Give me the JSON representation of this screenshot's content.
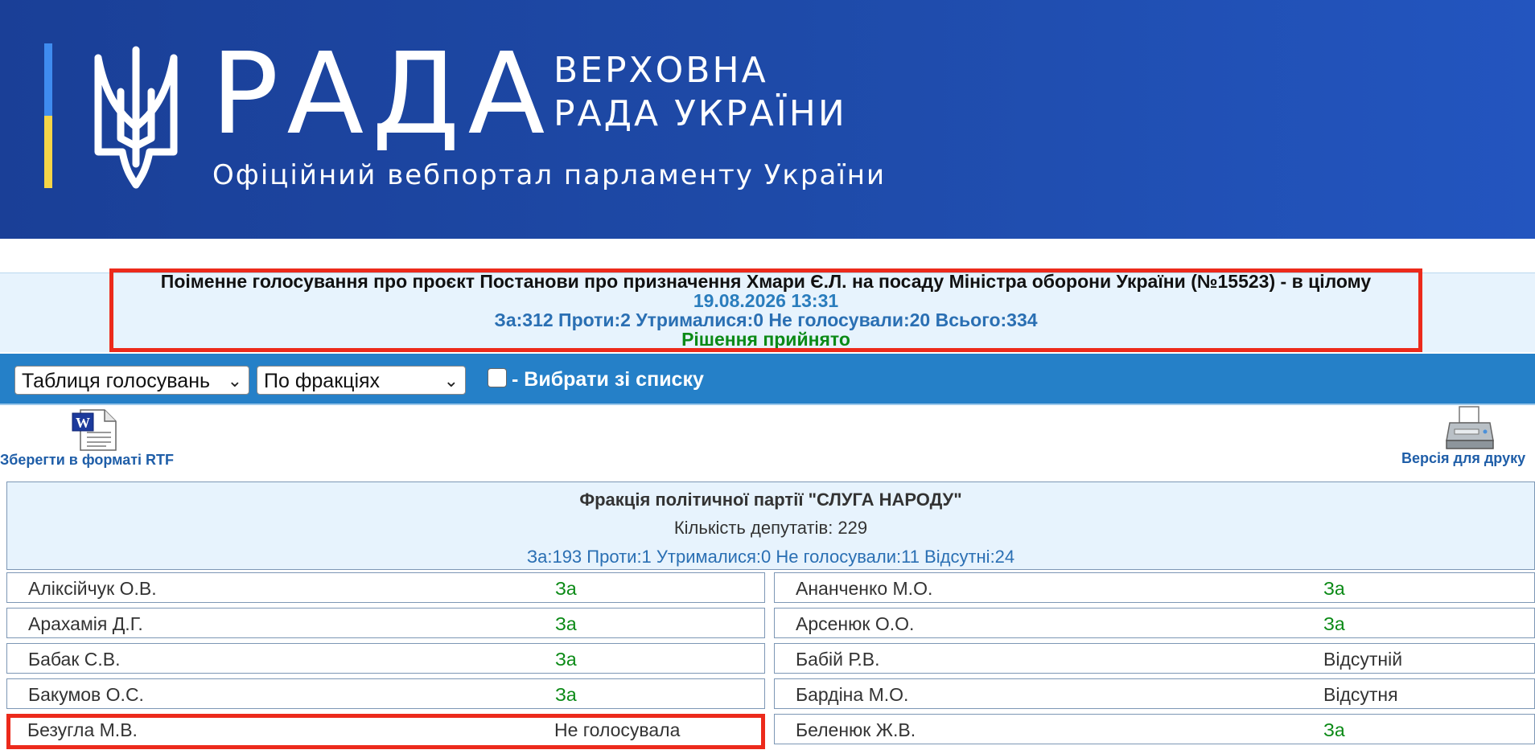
{
  "header": {
    "logo_word": "РАДА",
    "logo_sub1": "ВЕРХОВНА",
    "logo_sub2": "РАДА УКРАЇНИ",
    "tagline": "Офіційний вебпортал парламенту України",
    "icon": "trident-icon",
    "colors": {
      "background": "#1e4aa8",
      "flag_blue": "#3f8cf0",
      "flag_yellow": "#f5d547"
    }
  },
  "vote": {
    "title": "Поіменне голосування про проєкт Постанови про призначення Хмари Є.Л. на посаду Міністра оборони України (№15523) - в цілому",
    "datetime": "19.08.2026 13:31",
    "counts": "За:312 Проти:2 Утрималися:0 Не голосували:20 Всього:334",
    "result": "Рішення прийнято"
  },
  "toolbar": {
    "view_select": "Таблиця голосувань",
    "group_select": "По фракціях",
    "checkbox_label": "- Вибрати зі списку",
    "checkbox_checked": false
  },
  "export": {
    "rtf_label": "Зберегти в форматі RTF",
    "rtf_icon": "word-document-icon",
    "print_label": "Версія для друку",
    "print_icon": "printer-icon"
  },
  "faction": {
    "name": "Фракція політичної партії \"СЛУГА НАРОДУ\"",
    "count": "Кількість депутатів: 229",
    "votes": "За:193 Проти:1 Утрималися:0 Не голосували:11 Відсутні:24"
  },
  "deputies_left": [
    {
      "name": "Аліксійчук О.В.",
      "vote": "За"
    },
    {
      "name": "Арахамія Д.Г.",
      "vote": "За"
    },
    {
      "name": "Бабак С.В.",
      "vote": "За"
    },
    {
      "name": "Бакумов О.С.",
      "vote": "За"
    },
    {
      "name": "Безугла М.В.",
      "vote": "Не голосувала"
    }
  ],
  "deputies_right": [
    {
      "name": "Ананченко М.О.",
      "vote": "За"
    },
    {
      "name": "Арсенюк О.О.",
      "vote": "За"
    },
    {
      "name": "Бабій Р.В.",
      "vote": "Відсутній"
    },
    {
      "name": "Бардіна М.О.",
      "vote": "Відсутня"
    },
    {
      "name": "Беленюк Ж.В.",
      "vote": "За"
    }
  ],
  "colors": {
    "highlight": "#ec2a1b",
    "vote_for": "#0b8a16",
    "link": "#1f5ea8",
    "toolbar": "#2580c8"
  }
}
